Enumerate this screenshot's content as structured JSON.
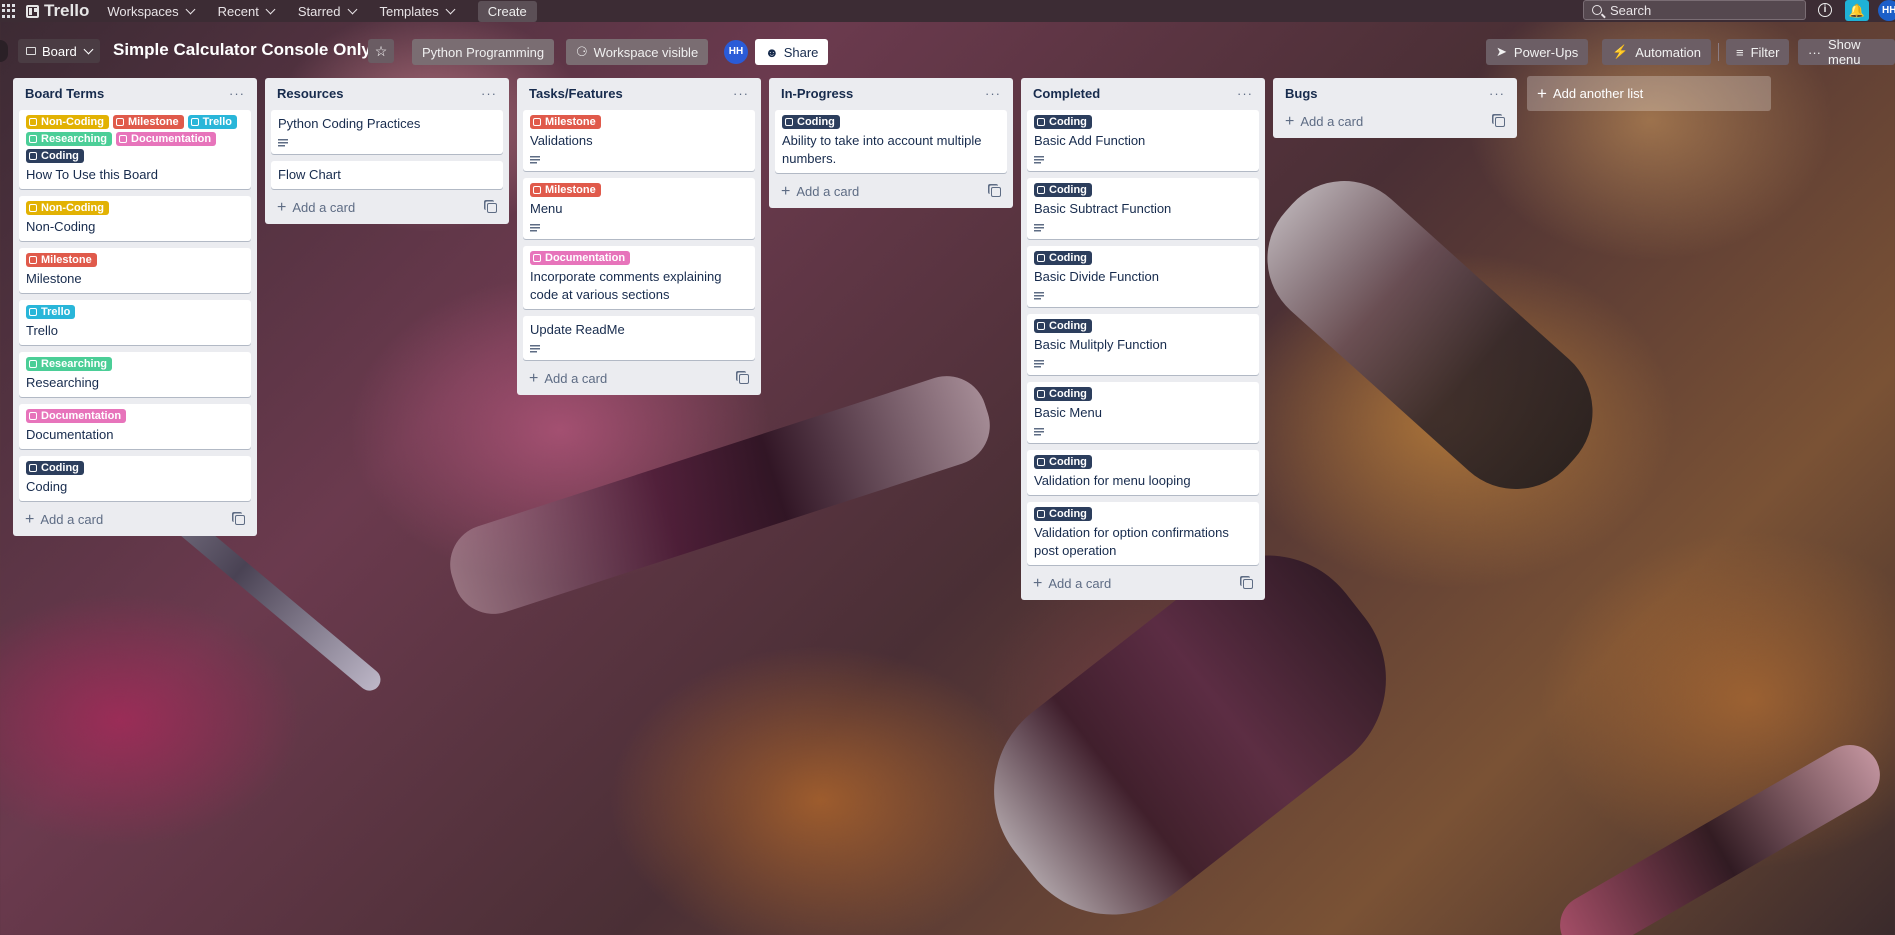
{
  "topnav": {
    "logo": "Trello",
    "menus": [
      "Workspaces",
      "Recent",
      "Starred",
      "Templates"
    ],
    "create": "Create",
    "search_placeholder": "Search",
    "avatar": "HH"
  },
  "board": {
    "view": "Board",
    "title": "Simple Calculator Console Only",
    "workspace": "Python Programming",
    "visibility": "Workspace visible",
    "member": "HH",
    "share": "Share",
    "powerups": "Power-Ups",
    "automation": "Automation",
    "filter": "Filter",
    "show_menu": "Show menu"
  },
  "label_colors": {
    "Non-Coding": "#e2b203",
    "Milestone": "#e05a4b",
    "Trello": "#29b6d9",
    "Researching": "#4bce97",
    "Documentation": "#e774bb",
    "Coding": "#2c3e5d"
  },
  "add_card": "Add a card",
  "add_list": "Add another list",
  "lists": [
    {
      "title": "Board Terms",
      "cards": [
        {
          "labels": [
            "Non-Coding",
            "Milestone",
            "Trello",
            "Researching",
            "Documentation",
            "Coding"
          ],
          "title": "How To Use this Board",
          "desc": false
        },
        {
          "labels": [
            "Non-Coding"
          ],
          "title": "Non-Coding",
          "desc": false
        },
        {
          "labels": [
            "Milestone"
          ],
          "title": "Milestone",
          "desc": false
        },
        {
          "labels": [
            "Trello"
          ],
          "title": "Trello",
          "desc": false
        },
        {
          "labels": [
            "Researching"
          ],
          "title": "Researching",
          "desc": false
        },
        {
          "labels": [
            "Documentation"
          ],
          "title": "Documentation",
          "desc": false
        },
        {
          "labels": [
            "Coding"
          ],
          "title": "Coding",
          "desc": false
        }
      ]
    },
    {
      "title": "Resources",
      "cards": [
        {
          "labels": [],
          "title": "Python Coding Practices",
          "desc": true
        },
        {
          "labels": [],
          "title": "Flow Chart",
          "desc": false
        }
      ]
    },
    {
      "title": "Tasks/Features",
      "cards": [
        {
          "labels": [
            "Milestone"
          ],
          "title": "Validations",
          "desc": true
        },
        {
          "labels": [
            "Milestone"
          ],
          "title": "Menu",
          "desc": true
        },
        {
          "labels": [
            "Documentation"
          ],
          "title": "Incorporate comments explaining code at various sections",
          "desc": false
        },
        {
          "labels": [],
          "title": "Update ReadMe",
          "desc": true
        }
      ]
    },
    {
      "title": "In-Progress",
      "cards": [
        {
          "labels": [
            "Coding"
          ],
          "title": "Ability to take into account multiple numbers.",
          "desc": false
        }
      ]
    },
    {
      "title": "Completed",
      "cards": [
        {
          "labels": [
            "Coding"
          ],
          "title": "Basic Add Function",
          "desc": true
        },
        {
          "labels": [
            "Coding"
          ],
          "title": "Basic Subtract Function",
          "desc": true
        },
        {
          "labels": [
            "Coding"
          ],
          "title": "Basic Divide Function",
          "desc": true
        },
        {
          "labels": [
            "Coding"
          ],
          "title": "Basic Mulitply Function",
          "desc": true
        },
        {
          "labels": [
            "Coding"
          ],
          "title": "Basic Menu",
          "desc": true
        },
        {
          "labels": [
            "Coding"
          ],
          "title": "Validation for menu looping",
          "desc": false
        },
        {
          "labels": [
            "Coding"
          ],
          "title": "Validation for option confirmations post operation",
          "desc": false
        }
      ]
    },
    {
      "title": "Bugs",
      "cards": []
    }
  ]
}
